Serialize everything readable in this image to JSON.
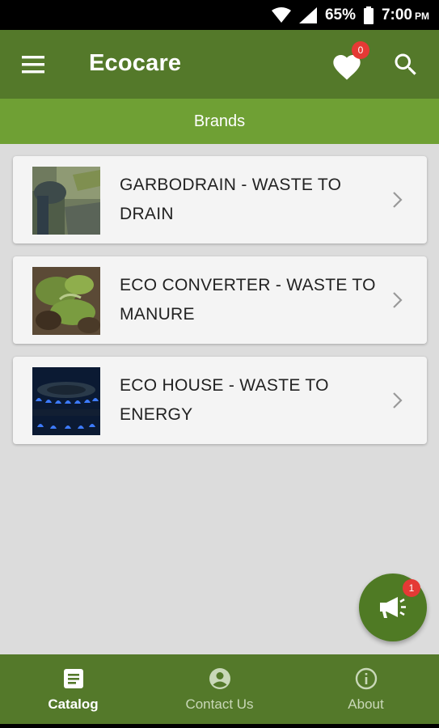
{
  "status_bar": {
    "battery": "65%",
    "time": "7:00",
    "ampm": "PM"
  },
  "app_bar": {
    "title": "Ecocare",
    "favorites_count": "0"
  },
  "sub_header": {
    "title": "Brands"
  },
  "brands": [
    {
      "label": "GARBODRAIN - WASTE TO DRAIN"
    },
    {
      "label": "ECO CONVERTER - WASTE TO MANURE"
    },
    {
      "label": "ECO HOUSE - WASTE TO ENERGY"
    }
  ],
  "fab": {
    "badge": "1",
    "icon": "megaphone-icon"
  },
  "bottom_nav": {
    "items": [
      {
        "label": "Catalog",
        "icon": "catalog-icon",
        "active": true
      },
      {
        "label": "Contact Us",
        "icon": "account-icon",
        "active": false
      },
      {
        "label": "About",
        "icon": "info-icon",
        "active": false
      }
    ]
  },
  "colors": {
    "app_bar": "#54792a",
    "sub_header": "#6fa034",
    "background": "#dcdcdc",
    "badge": "#e53935"
  }
}
